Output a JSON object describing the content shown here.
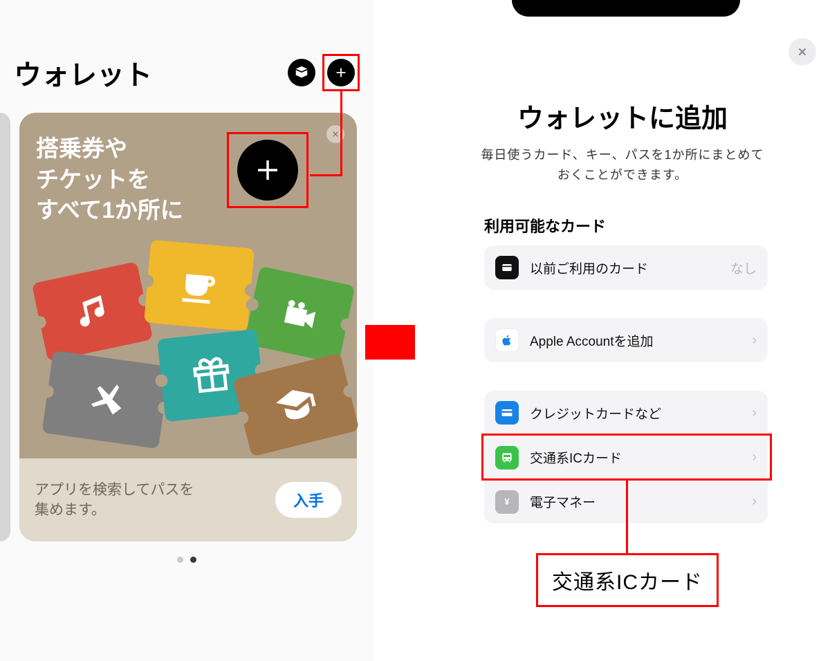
{
  "left": {
    "title": "ウォレット",
    "promo": {
      "headline_l1": "搭乗券や",
      "headline_l2": "チケットを",
      "headline_l3": "すべて1か所に",
      "footer_l1": "アプリを検索してパスを",
      "footer_l2": "集めます。",
      "get_button": "入手"
    }
  },
  "right": {
    "title": "ウォレットに追加",
    "subtitle_l1": "毎日使うカード、キー、パスを1か所にまとめて",
    "subtitle_l2": "おくことができます。",
    "section": "利用可能なカード",
    "options": {
      "previous": {
        "label": "以前ご利用のカード",
        "trail": "なし"
      },
      "apple": {
        "label": "Apple Accountを追加"
      },
      "credit": {
        "label": "クレジットカードなど"
      },
      "transit": {
        "label": "交通系ICカード"
      },
      "emoney": {
        "label": "電子マネー"
      }
    },
    "callout": "交通系ICカード"
  }
}
